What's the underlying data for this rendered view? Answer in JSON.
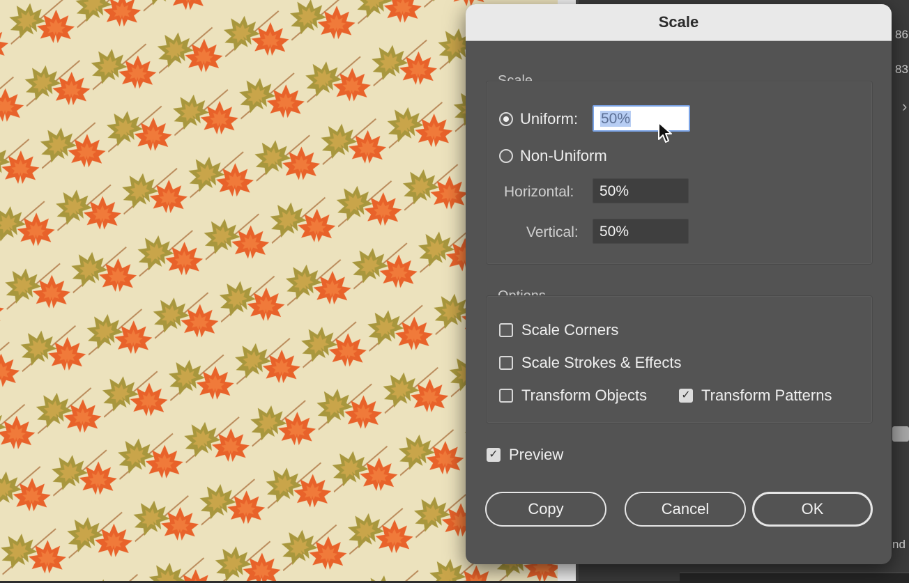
{
  "dialog": {
    "title": "Scale",
    "scale_group": {
      "label": "Scale",
      "uniform_label": "Uniform:",
      "uniform_value": "50%",
      "non_uniform_label": "Non-Uniform",
      "horizontal_label": "Horizontal:",
      "horizontal_value": "50%",
      "vertical_label": "Vertical:",
      "vertical_value": "50%",
      "selected": "uniform"
    },
    "options_group": {
      "label": "Options",
      "scale_corners": {
        "label": "Scale Corners",
        "checked": false
      },
      "scale_strokes": {
        "label": "Scale Strokes & Effects",
        "checked": false
      },
      "transform_objects": {
        "label": "Transform Objects",
        "checked": false
      },
      "transform_patterns": {
        "label": "Transform Patterns",
        "checked": true
      }
    },
    "preview": {
      "label": "Preview",
      "checked": true
    },
    "buttons": {
      "copy": "Copy",
      "cancel": "Cancel",
      "ok": "OK"
    }
  },
  "background": {
    "frag_1": "86",
    "frag_2": "83",
    "frag_3": "nd"
  },
  "colors": {
    "leaf_orange": "#e8622a",
    "leaf_olive": "#a99a3a",
    "paper": "#ece2bd",
    "dialog_bg": "#535353"
  }
}
